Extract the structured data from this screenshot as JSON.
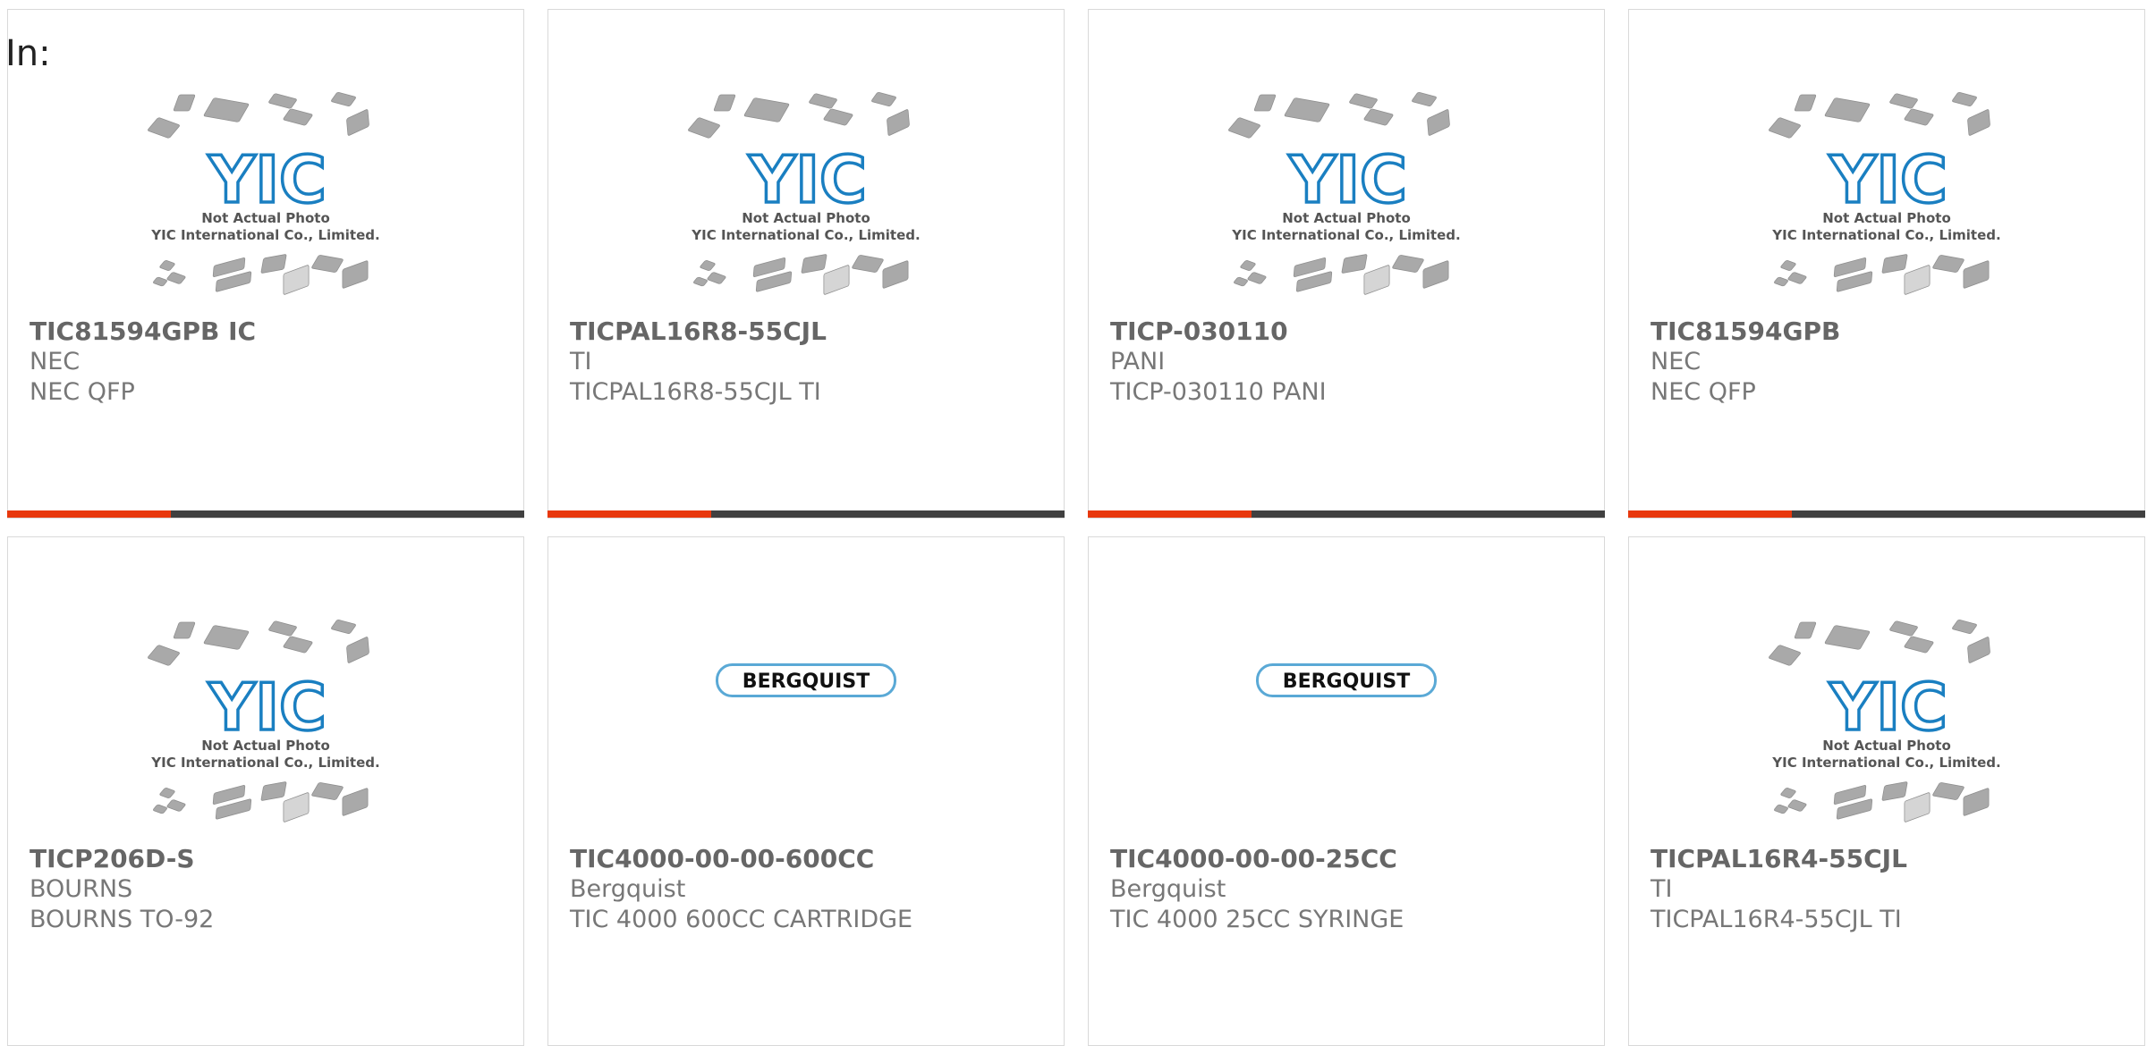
{
  "header": {
    "label": "In:"
  },
  "colors": {
    "accent": "#e8380d",
    "bar": "#404040",
    "yic_blue": "#1a7fc1",
    "chip_gray": "#a9a9a9"
  },
  "placeholder": {
    "line1": "Not Actual Photo",
    "line2": "YIC International Co., Limited.",
    "logo": "YIC"
  },
  "bergquist": {
    "logo": "BERGQUIST"
  },
  "products": [
    {
      "part": "TIC81594GPB IC",
      "maker": "NEC",
      "desc": "NEC QFP",
      "image": "yic-placeholder"
    },
    {
      "part": "TICPAL16R8-55CJL",
      "maker": "TI",
      "desc": "TICPAL16R8-55CJL TI",
      "image": "yic-placeholder"
    },
    {
      "part": "TICP-030110",
      "maker": "PANI",
      "desc": "TICP-030110 PANI",
      "image": "yic-placeholder"
    },
    {
      "part": "TIC81594GPB",
      "maker": "NEC",
      "desc": "NEC QFP",
      "image": "yic-placeholder"
    },
    {
      "part": "TICP206D-S",
      "maker": "BOURNS",
      "desc": "BOURNS TO-92",
      "image": "yic-placeholder"
    },
    {
      "part": "TIC4000-00-00-600CC",
      "maker": "Bergquist",
      "desc": "TIC 4000 600CC CARTRIDGE",
      "image": "bergquist-logo"
    },
    {
      "part": "TIC4000-00-00-25CC",
      "maker": "Bergquist",
      "desc": "TIC 4000 25CC SYRINGE",
      "image": "bergquist-logo"
    },
    {
      "part": "TICPAL16R4-55CJL",
      "maker": "TI",
      "desc": "TICPAL16R4-55CJL TI",
      "image": "yic-placeholder"
    }
  ]
}
